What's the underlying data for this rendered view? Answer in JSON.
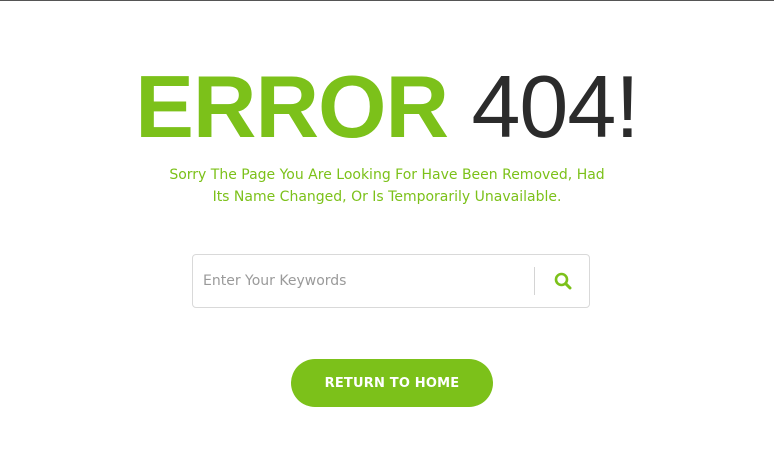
{
  "error_page": {
    "title_word": "ERROR",
    "title_code": "404!",
    "message_line1": "Sorry The Page You Are Looking For Have Been Removed, Had",
    "message_line2": "Its Name Changed, Or Is Temporarily Unavailable."
  },
  "search": {
    "placeholder": "Enter Your Keywords",
    "value": "",
    "icon": "search-icon"
  },
  "actions": {
    "home_label": "RETURN TO HOME"
  },
  "colors": {
    "accent": "#7cc11a",
    "title_dark": "#2b2b2b",
    "border": "#d9d9d9",
    "background": "#ffffff"
  }
}
